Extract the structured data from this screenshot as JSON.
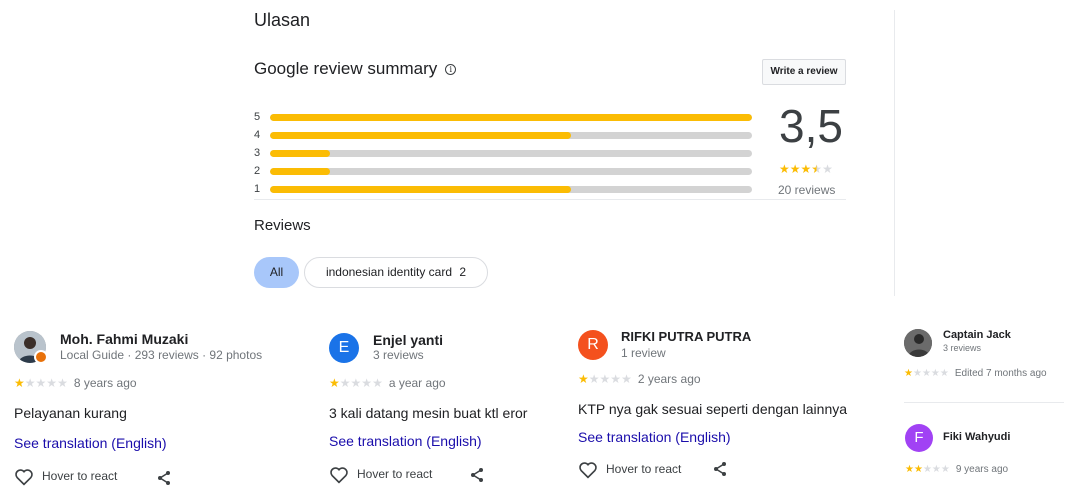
{
  "section_title": "Ulasan",
  "summary": {
    "title": "Google review summary",
    "info_symbol": "i",
    "write_review_label": "Write a review",
    "rating": "3,5",
    "rating_value": 3.5,
    "review_count": "20 reviews",
    "bars": [
      {
        "label": "5",
        "fraction": 1.0
      },
      {
        "label": "4",
        "fraction": 0.625
      },
      {
        "label": "3",
        "fraction": 0.125
      },
      {
        "label": "2",
        "fraction": 0.125
      },
      {
        "label": "1",
        "fraction": 0.625
      }
    ]
  },
  "reviews_heading": "Reviews",
  "filters": {
    "all_label": "All",
    "topic_label": "indonesian identity card",
    "topic_count": "2"
  },
  "reviews": [
    {
      "name": "Moh. Fahmi Muzaki",
      "meta": "Local Guide · 293 reviews · 92 photos",
      "stars": 1,
      "time": "8 years ago",
      "text": "Pelayanan kurang",
      "translate": "See translation (English)",
      "react": "Hover to react"
    },
    {
      "name": "Enjel yanti",
      "initial": "E",
      "meta": "3 reviews",
      "stars": 1,
      "time": "a year ago",
      "text": "3 kali datang mesin buat ktl eror",
      "translate": "See translation (English)",
      "react": "Hover to react"
    },
    {
      "name": "RIFKI PUTRA PUTRA",
      "initial": "R",
      "meta": "1 review",
      "stars": 1,
      "time": "2 years ago",
      "text": "KTP nya gak sesuai seperti dengan lainnya",
      "translate": "See translation (English)",
      "react": "Hover to react"
    },
    {
      "name": "Captain Jack",
      "meta": "3 reviews",
      "stars": 1,
      "time": "Edited 7 months ago"
    },
    {
      "name": "Fiki Wahyudi",
      "initial": "F",
      "stars": 2,
      "time": "9 years ago"
    }
  ],
  "colors": {
    "star": "#fbbc04",
    "bar_fill": "#fbbc04",
    "avatar_e": "#1a73e8",
    "avatar_r": "#f4511e",
    "avatar_f": "#a142f4",
    "link": "#1a0dab"
  },
  "icons": {
    "heart": "heart-outline-icon",
    "share": "share-icon",
    "info": "info-icon",
    "local_guide_badge": "local-guide-badge-icon"
  }
}
